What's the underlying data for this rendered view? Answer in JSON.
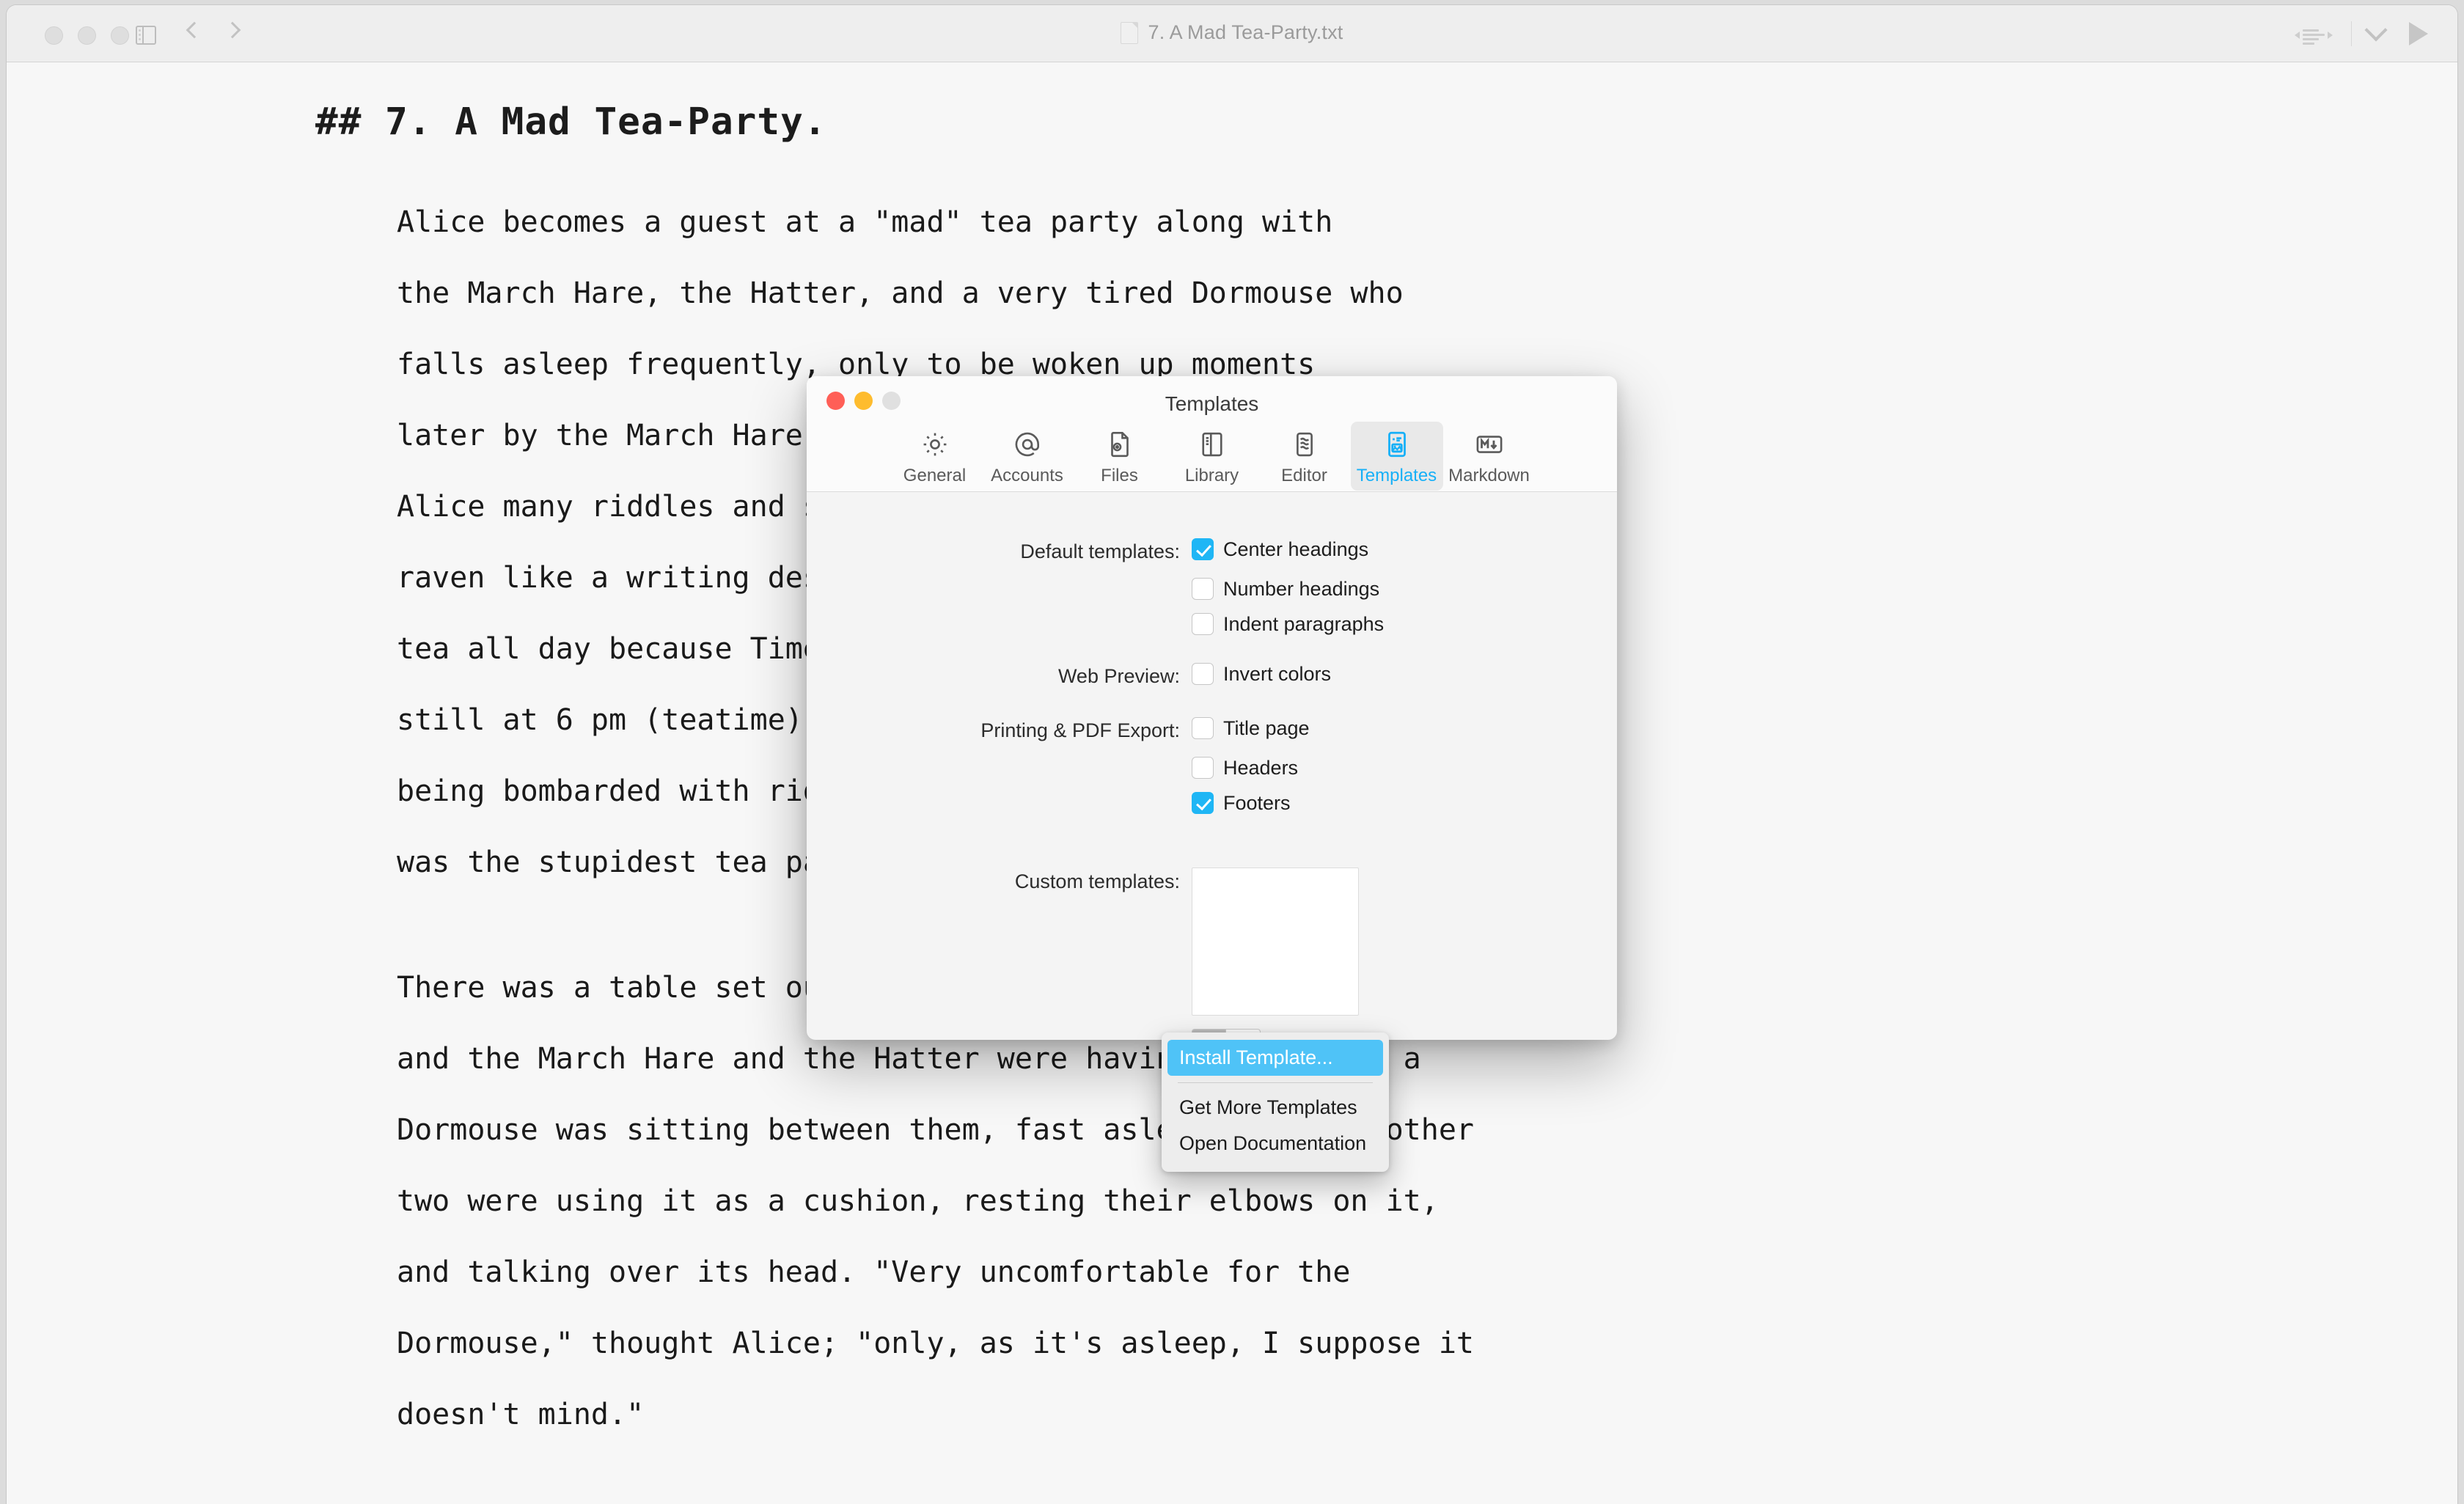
{
  "window": {
    "title": "7. A Mad Tea-Party.txt",
    "traffic_lights": [
      "close",
      "minimize",
      "zoom"
    ],
    "toolbar_icons": [
      "sidebar-toggle-icon",
      "nav-back-icon",
      "nav-fwd-icon",
      "layout-icon",
      "chevron-down-icon",
      "preview-play-icon"
    ]
  },
  "document": {
    "heading": "## 7. A Mad Tea-Party.",
    "paragraph_1": [
      "Alice becomes a guest at a \"mad\" tea party along with",
      "the March Hare, the Hatter, and a very tired Dormouse who",
      "falls asleep frequently, only to be woken up moments",
      "later by the March Hare and the Hatter. The characters give",
      "Alice many riddles and stories, including the famous \"Why is a",
      "raven like a writing desk?\". The Hatter reveals that they have",
      "tea all day because Time has punished him by eternally standing",
      "still at 6 pm (teatime). Alice becomes insulted and tired of",
      "being bombarded with riddles and she leaves claiming that it",
      "was the stupidest tea party that she had ever been to."
    ],
    "paragraph_2": [
      "There was a table set out under a tree in front of the house,",
      "and the March Hare and the Hatter were having tea at it: a",
      "Dormouse was sitting between them, fast asleep, and the other",
      "two were using it as a cushion, resting their elbows on it,",
      "and talking over its head. \"Very uncomfortable for the",
      "Dormouse,\" thought Alice; \"only, as it's asleep, I suppose it",
      "doesn't mind.\""
    ]
  },
  "preferences": {
    "title": "Templates",
    "accent_color": "#17b0f7",
    "checkbox_color": "#1fb6f5",
    "tabs": [
      {
        "label": "General",
        "icon": "gear-icon",
        "active": false
      },
      {
        "label": "Accounts",
        "icon": "at-sign-icon",
        "active": false
      },
      {
        "label": "Files",
        "icon": "file-plus-icon",
        "active": false
      },
      {
        "label": "Library",
        "icon": "library-icon",
        "active": false
      },
      {
        "label": "Editor",
        "icon": "editor-icon",
        "active": false
      },
      {
        "label": "Templates",
        "icon": "template-icon",
        "active": true
      },
      {
        "label": "Markdown",
        "icon": "markdown-icon",
        "active": false
      }
    ],
    "groups": [
      {
        "label": "Default templates:",
        "options": [
          {
            "label": "Center headings",
            "checked": true
          },
          {
            "label": "Number headings",
            "checked": false
          },
          {
            "label": "Indent paragraphs",
            "checked": false
          }
        ]
      },
      {
        "label": "Web Preview:",
        "options": [
          {
            "label": "Invert colors",
            "checked": false
          }
        ]
      },
      {
        "label": "Printing & PDF Export:",
        "options": [
          {
            "label": "Title page",
            "checked": false
          },
          {
            "label": "Headers",
            "checked": false
          },
          {
            "label": "Footers",
            "checked": true
          }
        ]
      }
    ],
    "custom_templates": {
      "label": "Custom templates:",
      "items": [],
      "add_button": "+",
      "remove_button": "−"
    }
  },
  "template_menu": {
    "items": [
      {
        "label": "Install Template...",
        "highlighted": true
      },
      {
        "label": "Get More Templates",
        "highlighted": false
      },
      {
        "label": "Open Documentation",
        "highlighted": false
      }
    ]
  }
}
